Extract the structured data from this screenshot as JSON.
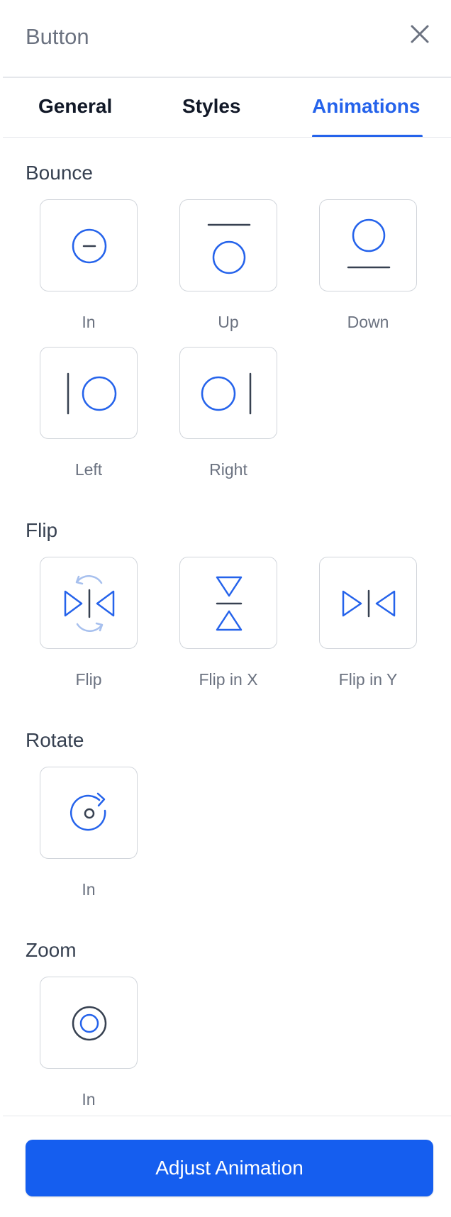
{
  "header": {
    "title": "Button"
  },
  "tabs": [
    {
      "label": "General",
      "active": false
    },
    {
      "label": "Styles",
      "active": false
    },
    {
      "label": "Animations",
      "active": true
    }
  ],
  "sections": [
    {
      "title": "Bounce",
      "items": [
        {
          "label": "In",
          "icon": "bounce-in-icon"
        },
        {
          "label": "Up",
          "icon": "bounce-up-icon"
        },
        {
          "label": "Down",
          "icon": "bounce-down-icon"
        },
        {
          "label": "Left",
          "icon": "bounce-left-icon"
        },
        {
          "label": "Right",
          "icon": "bounce-right-icon"
        }
      ]
    },
    {
      "title": "Flip",
      "items": [
        {
          "label": "Flip",
          "icon": "flip-icon"
        },
        {
          "label": "Flip in X",
          "icon": "flip-in-x-icon"
        },
        {
          "label": "Flip in Y",
          "icon": "flip-in-y-icon"
        }
      ]
    },
    {
      "title": "Rotate",
      "items": [
        {
          "label": "In",
          "icon": "rotate-in-icon"
        }
      ]
    },
    {
      "title": "Zoom",
      "items": [
        {
          "label": "In",
          "icon": "zoom-in-icon"
        }
      ]
    }
  ],
  "footer": {
    "button_label": "Adjust Animation"
  },
  "colors": {
    "accent": "#2563eb",
    "button": "#155eef",
    "icon_dark": "#374151",
    "icon_light": "#a7c0ee"
  }
}
